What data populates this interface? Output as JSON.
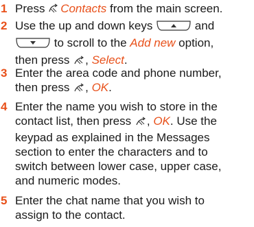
{
  "steps": [
    {
      "number": "1",
      "parts": {
        "a": "Press ",
        "ref": "Contacts",
        "b": " from the main screen.",
        "icon": "left-softkey-icon"
      }
    },
    {
      "number": "2",
      "parts": {
        "a": "Use the up and down keys ",
        "b": " and",
        "c": " to scroll to the ",
        "ref1": "Add new",
        "d": " option,",
        "e": "then press ",
        "comma": ", ",
        "ref2": "Select",
        "f": ".",
        "up_icon": "up-key-icon",
        "down_icon": "down-key-icon",
        "icon": "right-softkey-icon"
      }
    },
    {
      "number": "3",
      "parts": {
        "a": "Enter the area code and phone number,",
        "b": "then press ",
        "comma": ", ",
        "ref": "OK",
        "c": ".",
        "icon": "right-softkey-icon"
      }
    },
    {
      "number": "4",
      "parts": {
        "a": "Enter the name you wish to store in the",
        "b": "contact list, then press ",
        "comma": ", ",
        "ref": "OK",
        "c": ". Use the",
        "lines": [
          "keypad as explained in the Messages",
          "section to enter the characters and to",
          "switch between lower case, upper case,",
          "and numeric modes."
        ],
        "icon": "right-softkey-icon"
      }
    },
    {
      "number": "5",
      "parts": {
        "a": "Enter the chat name that you wish to",
        "b": "assign to the contact."
      }
    }
  ],
  "colors": {
    "accent": "#e8501a",
    "text": "#1a1a1a"
  }
}
